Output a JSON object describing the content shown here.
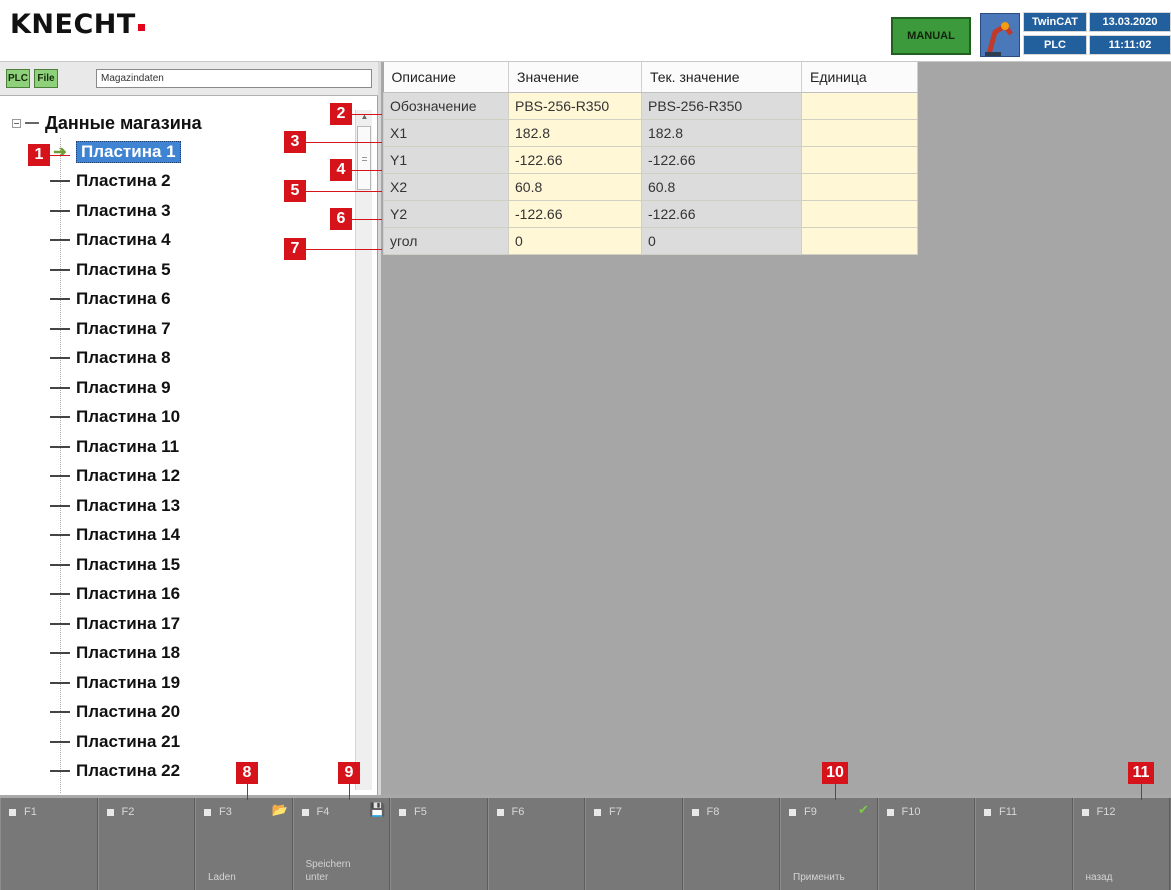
{
  "header": {
    "logo": "KNECHT",
    "mode": "MANUAL",
    "status": {
      "system": "TwinCAT",
      "date": "13.03.2020",
      "plc": "PLC",
      "time": "11:11:02"
    }
  },
  "left_toolbar": {
    "plc_button": "PLC",
    "file_button": "File",
    "path": "Magazindaten"
  },
  "tree": {
    "root": "Данные магазина",
    "items": [
      "Пластина 1",
      "Пластина 2",
      "Пластина 3",
      "Пластина 4",
      "Пластина 5",
      "Пластина 6",
      "Пластина 7",
      "Пластина 8",
      "Пластина 9",
      "Пластина 10",
      "Пластина 11",
      "Пластина 12",
      "Пластина 13",
      "Пластина 14",
      "Пластина 15",
      "Пластина 16",
      "Пластина 17",
      "Пластина 18",
      "Пластина 19",
      "Пластина 20",
      "Пластина 21",
      "Пластина 22"
    ],
    "selected_index": 0
  },
  "grid": {
    "columns": [
      "Описание",
      "Значение",
      "Тек. значение",
      "Единица"
    ],
    "rows": [
      {
        "desc": "Обозначение",
        "value": "PBS-256-R350",
        "current": "PBS-256-R350",
        "unit": ""
      },
      {
        "desc": "X1",
        "value": "182.8",
        "current": "182.8",
        "unit": ""
      },
      {
        "desc": "Y1",
        "value": "-122.66",
        "current": "-122.66",
        "unit": ""
      },
      {
        "desc": "X2",
        "value": "60.8",
        "current": "60.8",
        "unit": ""
      },
      {
        "desc": "Y2",
        "value": "-122.66",
        "current": "-122.66",
        "unit": ""
      },
      {
        "desc": "угол",
        "value": "0",
        "current": "0",
        "unit": ""
      }
    ]
  },
  "function_keys": [
    {
      "key": "F1",
      "caption": ""
    },
    {
      "key": "F2",
      "caption": ""
    },
    {
      "key": "F3",
      "caption": "Laden"
    },
    {
      "key": "F4",
      "caption": "Speichern unter"
    },
    {
      "key": "F5",
      "caption": ""
    },
    {
      "key": "F6",
      "caption": ""
    },
    {
      "key": "F7",
      "caption": ""
    },
    {
      "key": "F8",
      "caption": ""
    },
    {
      "key": "F9",
      "caption": "Применить"
    },
    {
      "key": "F10",
      "caption": ""
    },
    {
      "key": "F11",
      "caption": ""
    },
    {
      "key": "F12",
      "caption": "назад"
    }
  ],
  "callouts": [
    "1",
    "2",
    "3",
    "4",
    "5",
    "6",
    "7",
    "8",
    "9",
    "10",
    "11"
  ],
  "colors": {
    "selection": "#3f83d3",
    "callout": "#d6131b",
    "mode_badge": "#3c9a3c",
    "status_box": "#215f9d",
    "value_cell": "#fff7d6"
  }
}
